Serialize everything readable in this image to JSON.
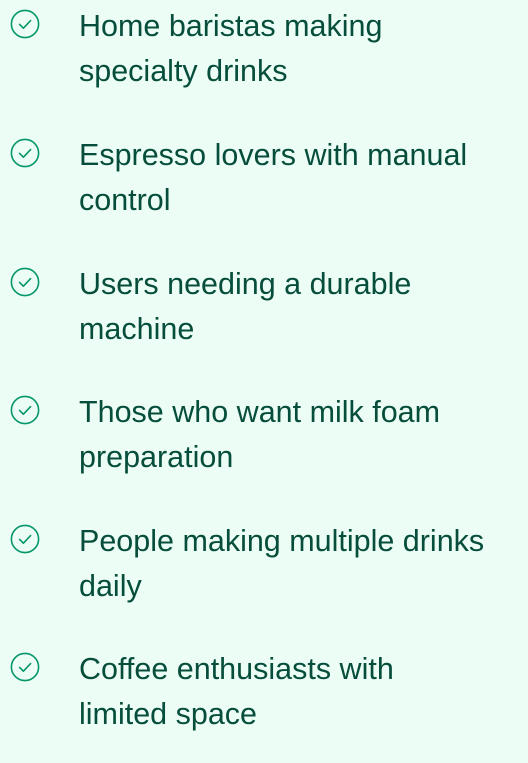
{
  "colors": {
    "background": "#ecfdf5",
    "text": "#064e3b",
    "check_icon": "#059669"
  },
  "list": {
    "icon": "check-circle-icon",
    "items": [
      {
        "line1": "Home baristas making",
        "line2": "specialty drinks"
      },
      {
        "line1": "Espresso lovers with manual",
        "line2": "control"
      },
      {
        "line1": "Users needing a durable",
        "line2": "machine"
      },
      {
        "line1": "Those who want milk foam",
        "line2": "preparation"
      },
      {
        "line1": "People making multiple drinks",
        "line2": "daily"
      },
      {
        "line1": "Coffee enthusiasts with",
        "line2": "limited space"
      }
    ]
  }
}
